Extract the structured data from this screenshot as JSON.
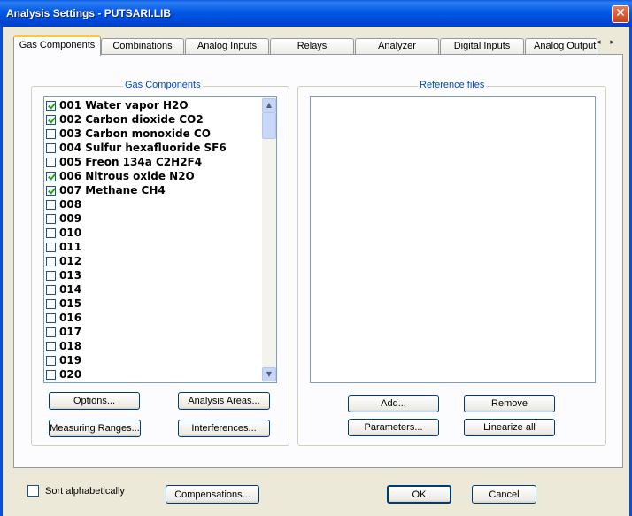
{
  "window": {
    "title": "Analysis Settings - PUTSARI.LIB",
    "close_glyph": "✕"
  },
  "tabs": [
    "Gas Components",
    "Combinations",
    "Analog Inputs",
    "Relays",
    "Analyzer",
    "Digital Inputs",
    "Analog Output"
  ],
  "tab_scroll_glyph": "◂ ▸",
  "gas_group": {
    "label": "Gas Components",
    "items": [
      {
        "label": "001 Water vapor H2O",
        "checked": true
      },
      {
        "label": "002 Carbon dioxide CO2",
        "checked": true
      },
      {
        "label": "003 Carbon monoxide CO",
        "checked": false
      },
      {
        "label": "004 Sulfur hexafluoride SF6",
        "checked": false
      },
      {
        "label": "005 Freon 134a C2H2F4",
        "checked": false
      },
      {
        "label": "006 Nitrous oxide N2O",
        "checked": true
      },
      {
        "label": "007 Methane CH4",
        "checked": true
      },
      {
        "label": "008",
        "checked": false
      },
      {
        "label": "009",
        "checked": false
      },
      {
        "label": "010",
        "checked": false
      },
      {
        "label": "011",
        "checked": false
      },
      {
        "label": "012",
        "checked": false
      },
      {
        "label": "013",
        "checked": false
      },
      {
        "label": "014",
        "checked": false
      },
      {
        "label": "015",
        "checked": false
      },
      {
        "label": "016",
        "checked": false
      },
      {
        "label": "017",
        "checked": false
      },
      {
        "label": "018",
        "checked": false
      },
      {
        "label": "019",
        "checked": false
      },
      {
        "label": "020",
        "checked": false
      }
    ],
    "buttons": {
      "options": "Options...",
      "analysis_areas": "Analysis Areas...",
      "measuring_ranges": "Measuring Ranges...",
      "interferences": "Interferences..."
    },
    "scroll_up_glyph": "▲",
    "scroll_down_glyph": "▼"
  },
  "ref_group": {
    "label": "Reference files",
    "buttons": {
      "add": "Add...",
      "remove": "Remove",
      "parameters": "Parameters...",
      "linearize_all": "Linearize all"
    }
  },
  "footer": {
    "sort_label": "Sort alphabetically",
    "sort_checked": false,
    "compensations": "Compensations...",
    "ok": "OK",
    "cancel": "Cancel"
  }
}
